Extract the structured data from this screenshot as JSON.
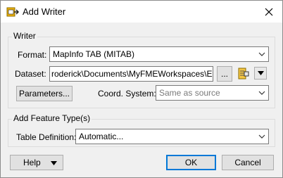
{
  "window": {
    "title": "Add Writer",
    "icon": "fme-add-writer-icon"
  },
  "writer_group": {
    "legend": "Writer",
    "format": {
      "label": "Format:",
      "value": "MapInfo TAB (MITAB)"
    },
    "dataset": {
      "label": "Dataset:",
      "value": "roderick\\Documents\\MyFMEWorkspaces\\Export",
      "browse_label": "..."
    },
    "parameters_label": "Parameters...",
    "coord_system": {
      "label": "Coord. System:",
      "placeholder": "Same as source"
    }
  },
  "feature_group": {
    "legend": "Add Feature Type(s)",
    "table_definition": {
      "label": "Table Definition:",
      "value": "Automatic..."
    }
  },
  "footer": {
    "help_label": "Help",
    "ok_label": "OK",
    "cancel_label": "Cancel"
  }
}
